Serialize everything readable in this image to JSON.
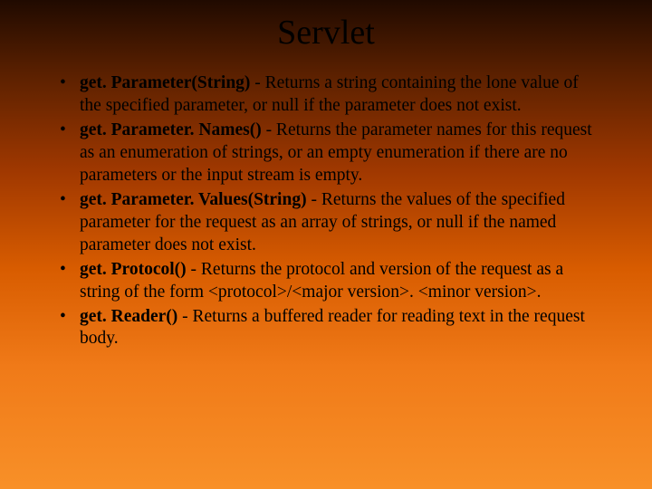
{
  "title": "Servlet",
  "items": [
    {
      "method": "get. Parameter(String)",
      "desc": " - Returns a string containing the lone value of the specified parameter, or null if the parameter does not exist."
    },
    {
      "method": "get. Parameter. Names()",
      "desc": " - Returns the parameter names for this request as an enumeration of strings, or an empty enumeration if there are no parameters or the input stream is empty."
    },
    {
      "method": "get. Parameter. Values(String)",
      "desc": " - Returns the values of the specified parameter for the request as an array of strings, or null if the named parameter does not exist."
    },
    {
      "method": "get. Protocol()",
      "desc": " - Returns the protocol and version of the request as a string of the form <protocol>/<major version>. <minor version>."
    },
    {
      "method": "get. Reader()",
      "desc": " - Returns a buffered reader for reading text in the request body."
    }
  ]
}
